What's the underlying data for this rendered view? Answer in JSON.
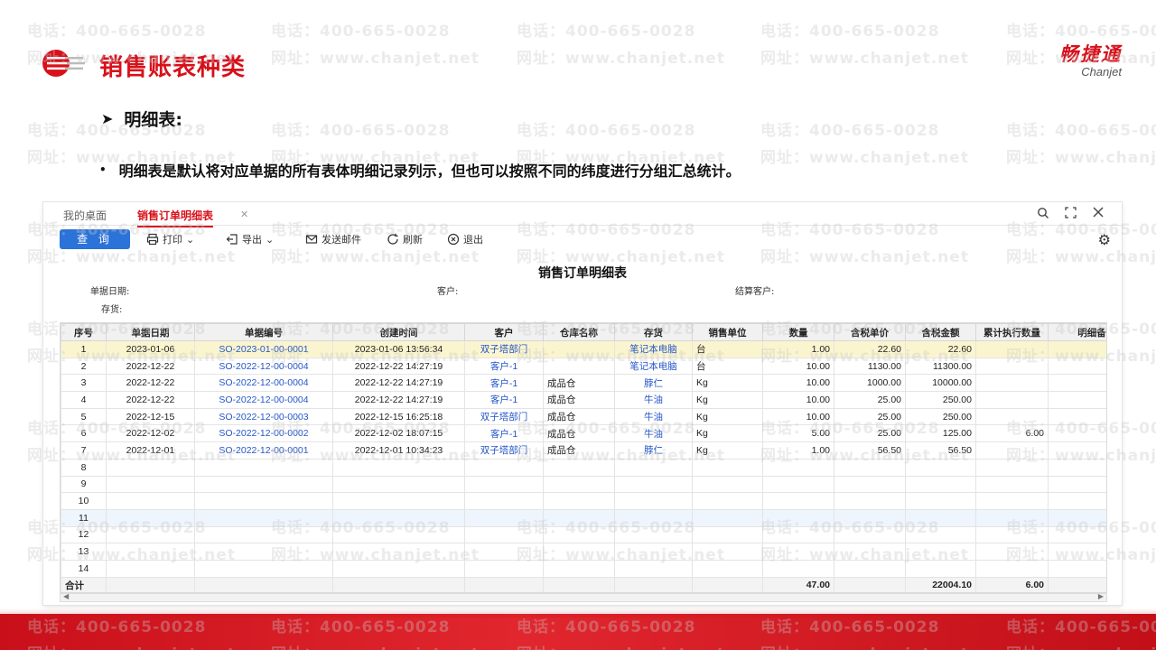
{
  "slide": {
    "title": "销售账表种类",
    "subtitle": "明细表:",
    "bullet": "明细表是默认将对应单据的所有表体明细记录列示，但也可以按照不同的纬度进行分组汇总统计。",
    "brand_cn": "畅捷通",
    "brand_en": "Chanjet"
  },
  "watermark": {
    "phone": "电话：400-665-0028",
    "site": "网址：www.chanjet.net"
  },
  "app": {
    "tabs": [
      {
        "label": "我的桌面"
      },
      {
        "label": "销售订单明细表"
      }
    ],
    "toolbar": {
      "query": "查 询",
      "print": "打印",
      "export": "导出",
      "send_mail": "发送邮件",
      "refresh": "刷新",
      "exit": "退出"
    },
    "report_title": "销售订单明细表",
    "filters": {
      "doc_date": "单据日期:",
      "customer": "客户:",
      "settle_customer": "结算客户:",
      "stock": "存货:"
    },
    "columns": [
      "序号",
      "单据日期",
      "单据编号",
      "创建时间",
      "客户",
      "仓库名称",
      "存货",
      "销售单位",
      "数量",
      "含税单价",
      "含税金额",
      "累计执行数量",
      "明细备"
    ],
    "rows": [
      [
        "1",
        "2023-01-06",
        "SO-2023-01-00-0001",
        "2023-01-06 13:56:34",
        "双子塔部门",
        "",
        "笔记本电脑",
        "台",
        "1.00",
        "22.60",
        "22.60",
        "",
        ""
      ],
      [
        "2",
        "2022-12-22",
        "SO-2022-12-00-0004",
        "2022-12-22 14:27:19",
        "客户-1",
        "",
        "笔记本电脑",
        "台",
        "10.00",
        "1130.00",
        "11300.00",
        "",
        ""
      ],
      [
        "3",
        "2022-12-22",
        "SO-2022-12-00-0004",
        "2022-12-22 14:27:19",
        "客户-1",
        "成品仓",
        "脖仁",
        "Kg",
        "10.00",
        "1000.00",
        "10000.00",
        "",
        ""
      ],
      [
        "4",
        "2022-12-22",
        "SO-2022-12-00-0004",
        "2022-12-22 14:27:19",
        "客户-1",
        "成品仓",
        "牛油",
        "Kg",
        "10.00",
        "25.00",
        "250.00",
        "",
        ""
      ],
      [
        "5",
        "2022-12-15",
        "SO-2022-12-00-0003",
        "2022-12-15 16:25:18",
        "双子塔部门",
        "成品仓",
        "牛油",
        "Kg",
        "10.00",
        "25.00",
        "250.00",
        "",
        ""
      ],
      [
        "6",
        "2022-12-02",
        "SO-2022-12-00-0002",
        "2022-12-02 18:07:15",
        "客户-1",
        "成品仓",
        "牛油",
        "Kg",
        "5.00",
        "25.00",
        "125.00",
        "6.00",
        ""
      ],
      [
        "7",
        "2022-12-01",
        "SO-2022-12-00-0001",
        "2022-12-01 10:34:23",
        "双子塔部门",
        "成品仓",
        "脖仁",
        "Kg",
        "1.00",
        "56.50",
        "56.50",
        "",
        ""
      ],
      [
        "8",
        "",
        "",
        "",
        "",
        "",
        "",
        "",
        "",
        "",
        "",
        "",
        ""
      ],
      [
        "9",
        "",
        "",
        "",
        "",
        "",
        "",
        "",
        "",
        "",
        "",
        "",
        ""
      ],
      [
        "10",
        "",
        "",
        "",
        "",
        "",
        "",
        "",
        "",
        "",
        "",
        "",
        ""
      ],
      [
        "11",
        "",
        "",
        "",
        "",
        "",
        "",
        "",
        "",
        "",
        "",
        "",
        ""
      ],
      [
        "12",
        "",
        "",
        "",
        "",
        "",
        "",
        "",
        "",
        "",
        "",
        "",
        ""
      ],
      [
        "13",
        "",
        "",
        "",
        "",
        "",
        "",
        "",
        "",
        "",
        "",
        "",
        ""
      ],
      [
        "14",
        "",
        "",
        "",
        "",
        "",
        "",
        "",
        "",
        "",
        "",
        "",
        ""
      ]
    ],
    "total": {
      "label": "合计",
      "qty": "47.00",
      "amount": "22004.10",
      "executed": "6.00"
    }
  }
}
